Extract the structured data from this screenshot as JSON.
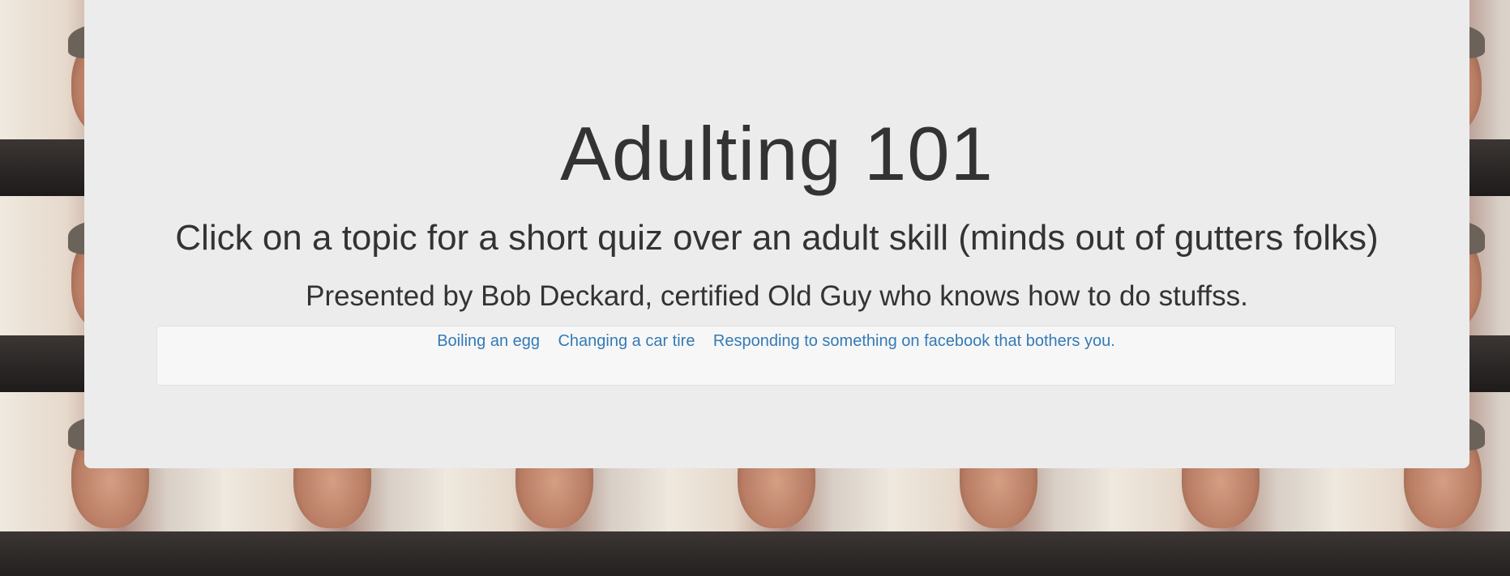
{
  "page": {
    "title": "Adulting 101",
    "subtitle": "Click on a topic for a short quiz over an adult skill (minds out of gutters folks)",
    "presenter": "Presented by Bob Deckard, certified Old Guy who knows how to do stuffss."
  },
  "topics": [
    "Boiling an egg",
    "Changing a car tire",
    "Responding to something on facebook that bothers you."
  ],
  "colors": {
    "panel_bg": "#ececec",
    "text": "#333333",
    "link": "#337ab7",
    "nav_bg": "#f7f7f7"
  }
}
